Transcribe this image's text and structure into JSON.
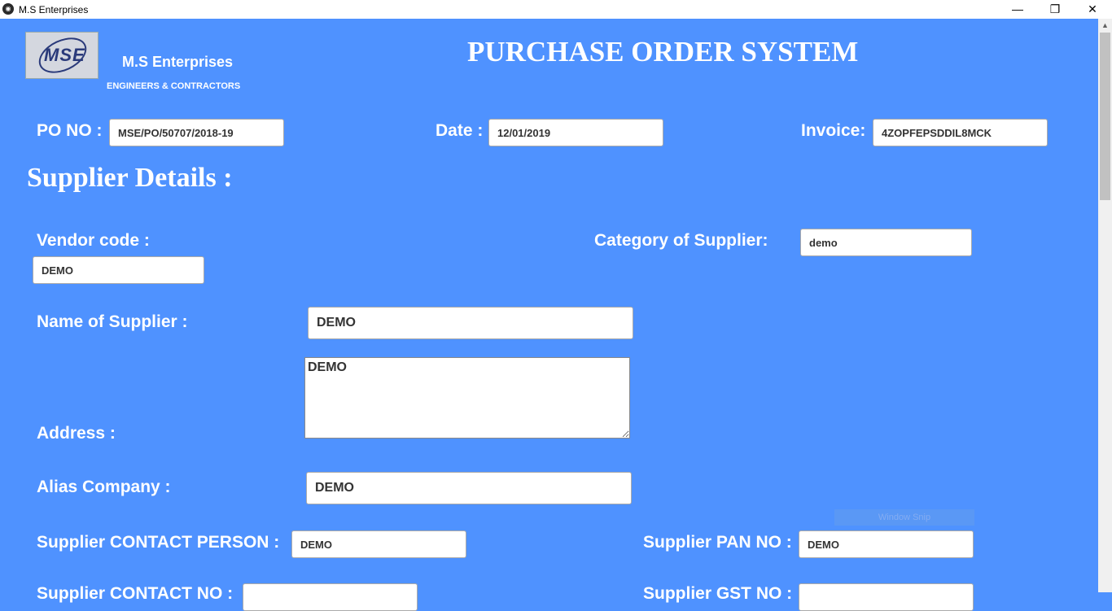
{
  "window": {
    "title": "M.S Enterprises",
    "minimize": "—",
    "restore": "❐",
    "close": "✕"
  },
  "header": {
    "logo_text": "MSE",
    "company_name": "M.S Enterprises",
    "tagline": "ENGINEERS & CONTRACTORS",
    "title": "PURCHASE ORDER SYSTEM"
  },
  "order": {
    "po_label": "PO NO :",
    "po_value": "MSE/PO/50707/2018-19",
    "date_label": "Date :",
    "date_value": "12/01/2019",
    "invoice_label": "Invoice:",
    "invoice_value": "4ZOPFEPSDDIL8MCK"
  },
  "supplier": {
    "section_title": "Supplier Details :",
    "vendor_code_label": "Vendor code :",
    "vendor_code_value": "DEMO",
    "category_label": "Category of Supplier:",
    "category_value": "demo",
    "name_label": "Name of Supplier :",
    "name_value": "DEMO",
    "address_label": "Address :",
    "address_value": "DEMO",
    "alias_label": "Alias Company :",
    "alias_value": "DEMO",
    "contact_person_label": "Supplier CONTACT PERSON :",
    "contact_person_value": "DEMO",
    "pan_label": "Supplier PAN NO :",
    "pan_value": "DEMO",
    "contact_no_label": "Supplier CONTACT NO :",
    "gst_label": "Supplier GST NO :"
  },
  "overlay": {
    "snip_label": "Window Snip"
  },
  "colors": {
    "background": "#4f92ff",
    "titlebar": "#ffffff",
    "text": "#ffffff"
  }
}
